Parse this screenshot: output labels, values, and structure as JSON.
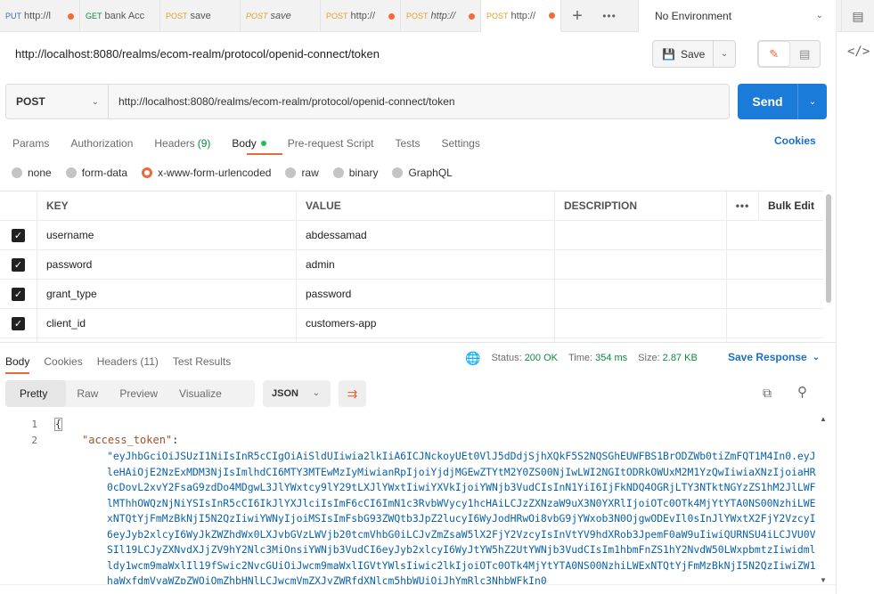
{
  "tabs": [
    {
      "method": "PUT",
      "label": "http://l",
      "style": "put",
      "italic": false
    },
    {
      "method": "GET",
      "label": "bank Acc",
      "style": "get",
      "italic": false
    },
    {
      "method": "POST",
      "label": "save",
      "style": "post",
      "italic": false
    },
    {
      "method": "POST",
      "label": "save",
      "style": "post",
      "italic": true
    },
    {
      "method": "POST",
      "label": "http://",
      "style": "post",
      "italic": false
    },
    {
      "method": "POST",
      "label": "http://",
      "style": "post",
      "italic": true
    },
    {
      "method": "POST",
      "label": "http://",
      "style": "post",
      "italic": false,
      "active": true
    }
  ],
  "environment": "No Environment",
  "request": {
    "name": "http://localhost:8080/realms/ecom-realm/protocol/openid-connect/token",
    "method": "POST",
    "url": "http://localhost:8080/realms/ecom-realm/protocol/openid-connect/token",
    "save_label": "Save",
    "send_label": "Send"
  },
  "req_tabs": {
    "params": "Params",
    "authorization": "Authorization",
    "headers": "Headers",
    "headers_count": "(9)",
    "body": "Body",
    "prerequest": "Pre-request Script",
    "tests": "Tests",
    "settings": "Settings",
    "cookies": "Cookies"
  },
  "body_types": {
    "none": "none",
    "form_data": "form-data",
    "urlencoded": "x-www-form-urlencoded",
    "raw": "raw",
    "binary": "binary",
    "graphql": "GraphQL"
  },
  "params": {
    "headers": {
      "key": "KEY",
      "value": "VALUE",
      "description": "DESCRIPTION",
      "bulk": "Bulk Edit",
      "more": "•••"
    },
    "rows": [
      {
        "key": "username",
        "value": "abdessamad"
      },
      {
        "key": "password",
        "value": "admin"
      },
      {
        "key": "grant_type",
        "value": "password"
      },
      {
        "key": "client_id",
        "value": "customers-app"
      }
    ]
  },
  "response": {
    "tabs": {
      "body": "Body",
      "cookies": "Cookies",
      "headers": "Headers (11)",
      "tests": "Test Results"
    },
    "status_label": "Status:",
    "status": "200 OK",
    "time_label": "Time:",
    "time": "354 ms",
    "size_label": "Size:",
    "size": "2.87 KB",
    "save_response": "Save Response",
    "views": {
      "pretty": "Pretty",
      "raw": "Raw",
      "preview": "Preview",
      "visualize": "Visualize"
    },
    "format": "JSON",
    "lines": [
      "1",
      "2"
    ],
    "open_brace": "{",
    "key": "\"access_token\"",
    "colon": ":",
    "token": "\"eyJhbGciOiJSUzI1NiIsInR5cCIgOiAiSldUIiwia2lkIiA6ICJNckoyUEt0VlJ5dDdjSjhXQkF5S2NQSGhEUWFBS1BrODZWb0tiZmFQT1M4In0.eyJleHAiOjE2NzExMDM3NjIsImlhdCI6MTY3MTEwMzIyMiwianRpIjoiYjdjMGEwZTYtM2Y0ZS00NjIwLWI2NGItODRkOWUxM2M1YzQwIiwiaXNzIjoiaHR0cDovL2xvY2FsaG9zdDo4MDgwL3JlYWxtcy9lY29tLXJlYWxtIiwiYXVkIjoiYWNjb3VudCIsInN1YiI6IjFkNDQ4OGRjLTY3NTktNGYzZS1hM2JlLWFlMThhOWQzNjNiYSIsInR5cCI6IkJlYXJlciIsImF6cCI6ImN1c3RvbWVycy1hcHAiLCJzZXNzaW9uX3N0YXRlIjoiOTc0OTk4MjYtYTA0NS00NzhiLWExNTQtYjFmMzBkNjI5N2QzIiwiYWNyIjoiMSIsImFsbG93ZWQtb3JpZ2lucyI6WyJodHRwOi8vbG9jYWxob3N0OjgwODEvIl0sInJlYWxtX2FjY2VzcyI6eyJyb2xlcyI6WyJkZWZhdWx0LXJvbGVzLWVjb20tcmVhbG0iLCJvZmZsaW5lX2FjY2VzcyIsInVtYV9hdXRob3JpemF0aW9uIiwiQURNSU4iLCJVU0VSIl19LCJyZXNvdXJjZV9hY2Nlc3MiOnsiYWNjb3VudCI6eyJyb2xlcyI6WyJtYW5hZ2UtYWNjb3VudCIsIm1hbmFnZS1hY2NvdW50LWxpbmtzIiwidmlldy1wcm9maWxlIl19fSwic2NvcGUiOiJwcm9maWxlIGVtYWlsIiwic2lkIjoiOTc0OTk4MjYtYTA0NS00NzhiLWExNTQtYjFmMzBkNjI5N2QzIiwiZW1haWxfdmVyaWZpZWQiOmZhbHNlLCJwcmVmZXJyZWRfdXNlcm5hbWUiOiJhYmRlc3NhbWFkIn0"
  }
}
